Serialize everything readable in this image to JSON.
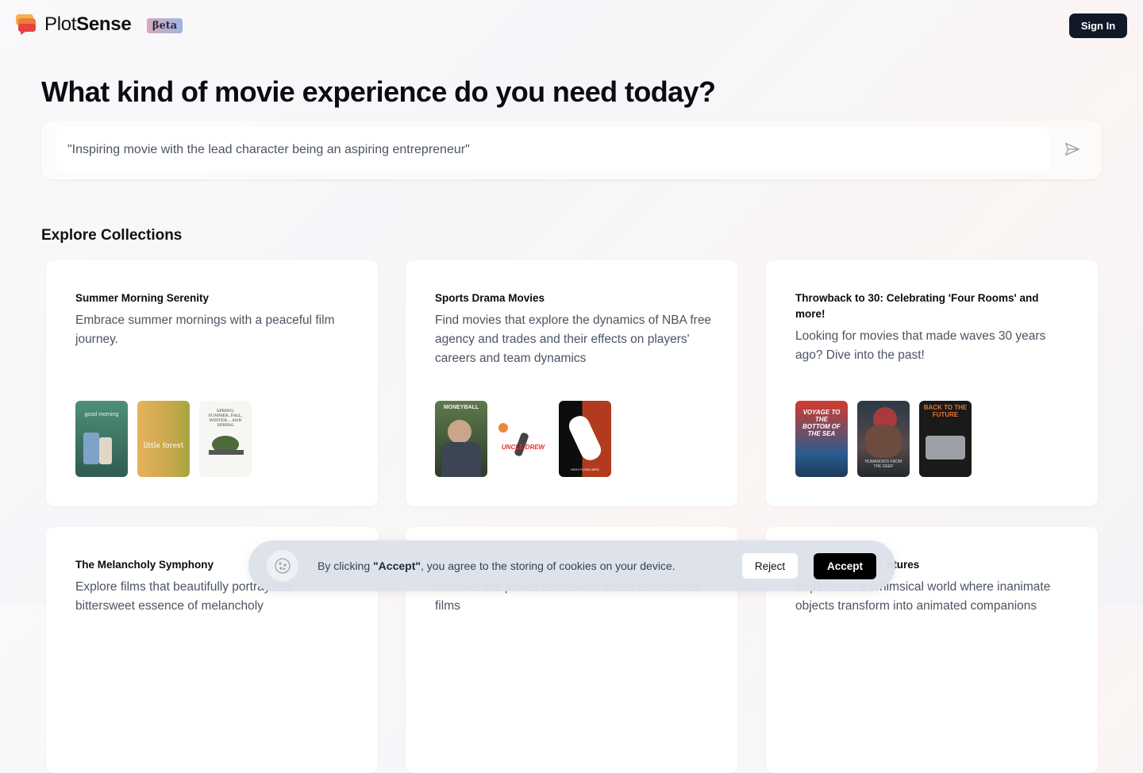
{
  "header": {
    "brand_plain": "Plot",
    "brand_bold": "Sense",
    "beta_label": "βeta",
    "signin_label": "Sign In"
  },
  "hero": {
    "title": "What kind of movie experience do you need today?",
    "search_placeholder": "\"Inspiring movie with the lead character being an aspiring entrepreneur\""
  },
  "collections": {
    "section_title": "Explore Collections",
    "cards": [
      {
        "title": "Summer Morning Serenity",
        "description": "Embrace summer mornings with a peaceful film journey.",
        "posters": [
          {
            "text": "good morning",
            "bg": "#3f7a6a"
          },
          {
            "text": "little forest",
            "bg": "#c7a64a"
          },
          {
            "text": "SPRING, SUMMER, FALL, WINTER... AND SPRING",
            "bg": "#f4f4f0"
          }
        ]
      },
      {
        "title": "Sports Drama Movies",
        "description": "Find movies that explore the dynamics of NBA free agency and trades and their effects on players' careers and team dynamics",
        "posters": [
          {
            "text": "MONEYBALL",
            "bg": "#3d5a3a"
          },
          {
            "text": "UNCLE DREW",
            "bg": "#ffffff"
          },
          {
            "text": "HIGH FLYING BIRD",
            "bg": "#b23a1e"
          }
        ]
      },
      {
        "title": "Throwback to 30: Celebrating 'Four Rooms' and more!",
        "description": "Looking for movies that made waves 30 years ago? Dive into the past!",
        "posters": [
          {
            "text": "VOYAGE TO THE BOTTOM OF THE SEA",
            "bg": "#b8222a"
          },
          {
            "text": "HUMANOIDS FROM THE DEEP",
            "bg": "#2d3b46"
          },
          {
            "text": "BACK TO THE FUTURE",
            "bg": "#1c1c1c"
          }
        ]
      },
      {
        "title": "The Melancholy Symphony",
        "description": "Explore films that beautifully portray the bittersweet essence of melancholy"
      },
      {
        "title": "",
        "description": "Uncover the power of music in these educational films"
      },
      {
        "title": "ntures",
        "description": "Experience a whimsical world where inanimate objects transform into animated companions"
      }
    ]
  },
  "cookie": {
    "text_prefix": "By clicking ",
    "text_bold": "\"Accept\"",
    "text_suffix": ", you agree to the storing of cookies on your device.",
    "reject_label": "Reject",
    "accept_label": "Accept"
  },
  "colors": {
    "primary_dark": "#111827",
    "accent_gradient_start": "#d9a9b8",
    "accent_gradient_end": "#9cb6e2",
    "logo_orange": "#f08a3c",
    "logo_red": "#e8423f"
  }
}
